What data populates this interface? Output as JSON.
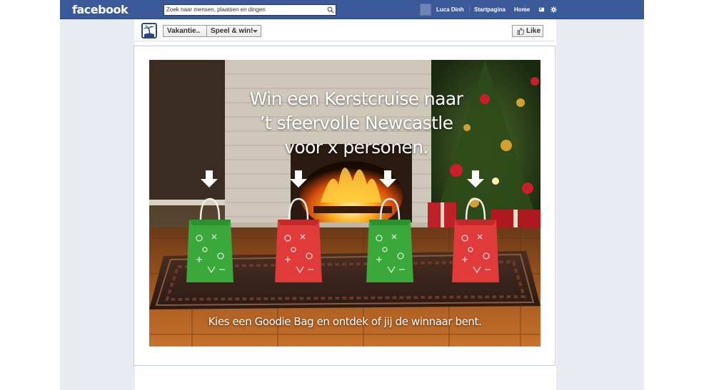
{
  "topbar": {
    "logo": "facebook",
    "search_placeholder": "Zoek naar mensen, plaatsen en dingen",
    "user_name": "Luca Dinh",
    "nav": [
      "Startpagina",
      "Home"
    ],
    "icons": [
      "friend-requests-icon",
      "messages-icon",
      "notifications-icon",
      "search-icon",
      "privacy-icon",
      "settings-gear-icon"
    ]
  },
  "app_header": {
    "app_label": "Vakantie..",
    "tab_label": "Speel & win!",
    "like_label": "Like"
  },
  "scene": {
    "headline": [
      "Win een Kerstcruise naar",
      "’t sfeervolle Newcastle",
      "voor x personen."
    ],
    "footer": "Kies een Goodie Bag en ontdek of jij de winnaar bent.",
    "bags": [
      {
        "color": "green"
      },
      {
        "color": "red"
      },
      {
        "color": "green"
      },
      {
        "color": "red"
      }
    ]
  },
  "colors": {
    "fb_blue": "#3b5998",
    "bag_green": "#3aa83a",
    "bag_red": "#e03a3a"
  }
}
